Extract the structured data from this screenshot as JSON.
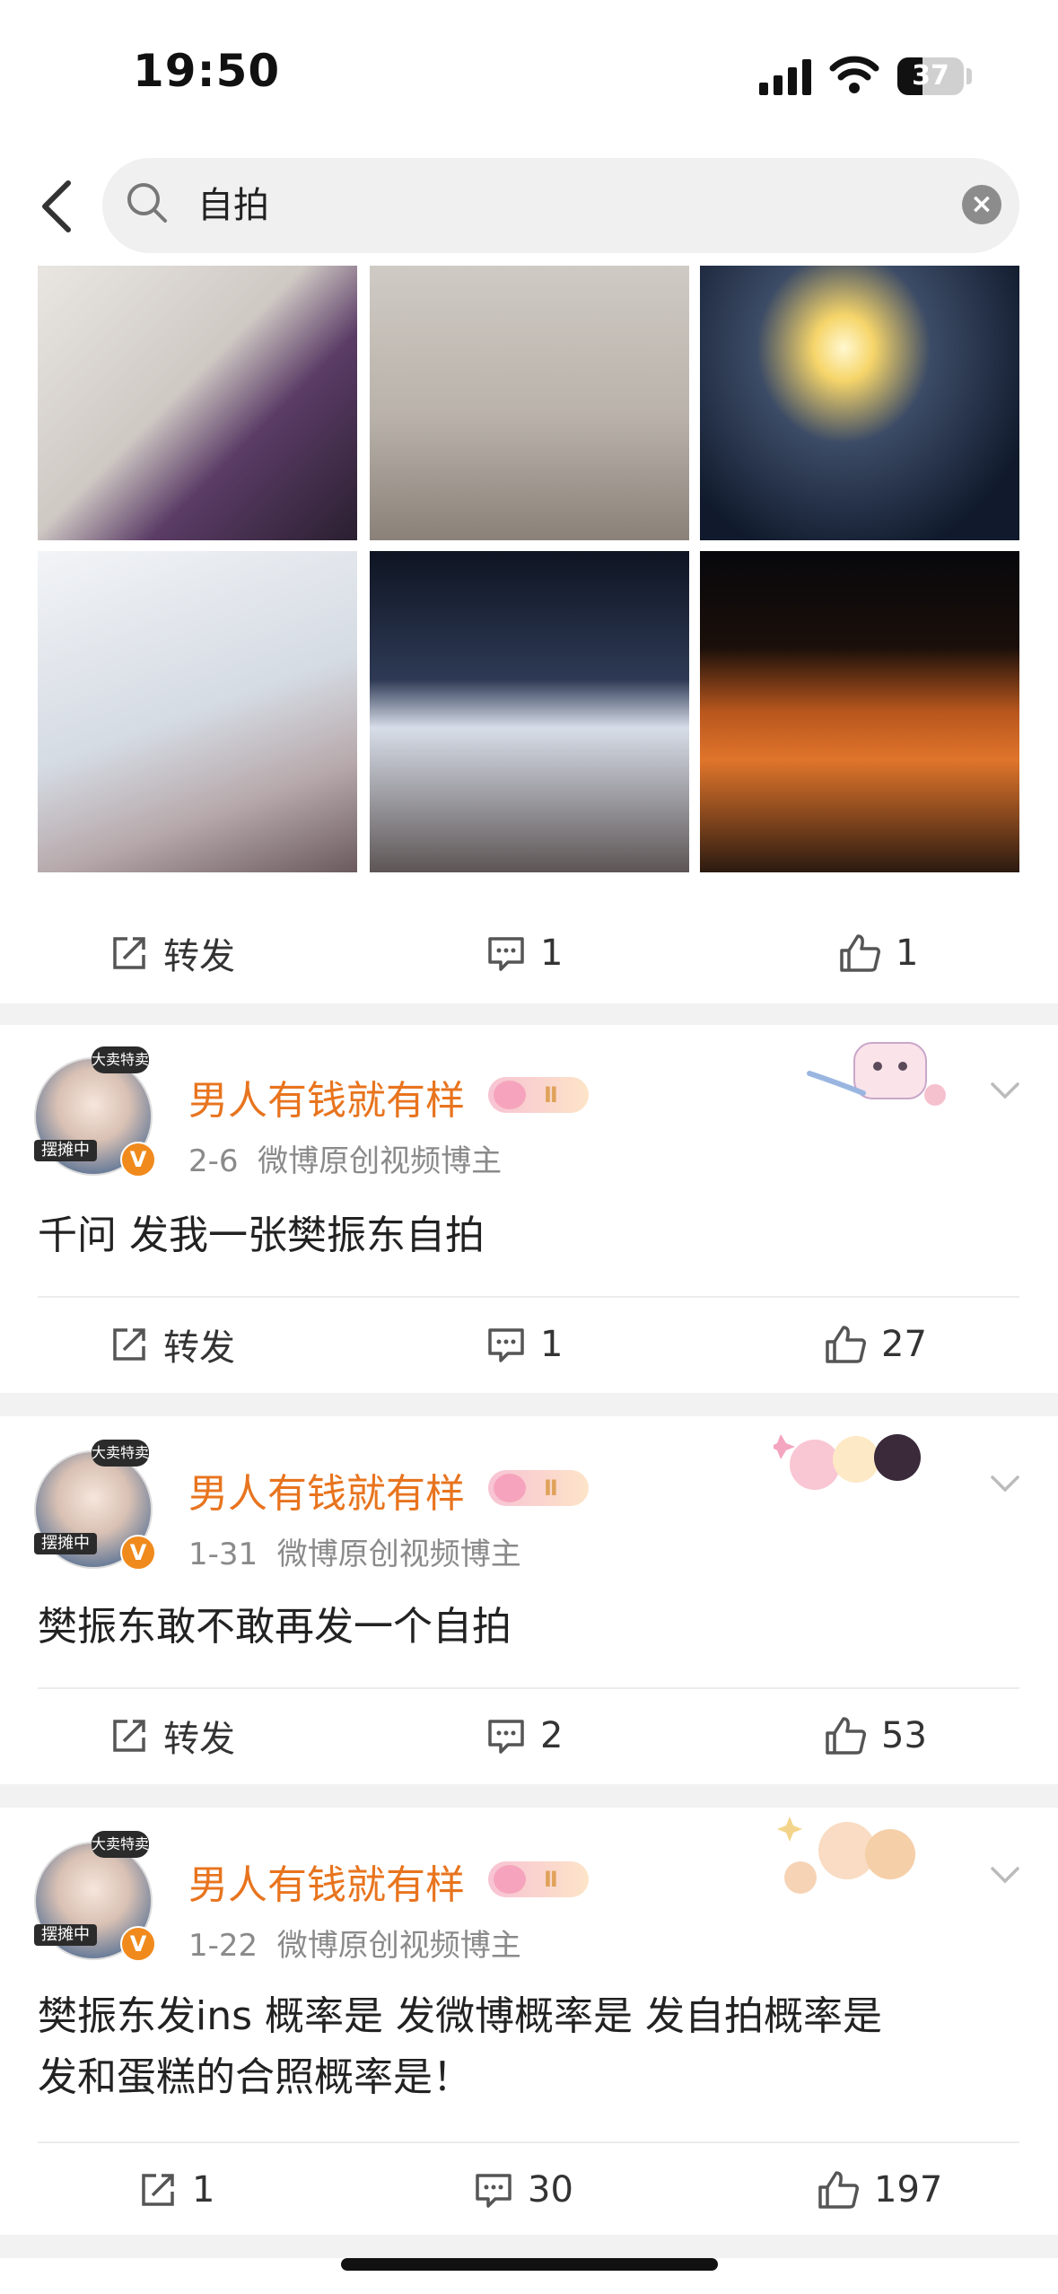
{
  "status_bar": {
    "time": "19:50",
    "battery": "37"
  },
  "search": {
    "query": "自拍"
  },
  "posts": [
    {
      "actions": {
        "repost": "转发",
        "comments": "1",
        "likes": "1"
      }
    },
    {
      "username": "男人有钱就有样",
      "date": "2-6",
      "source": "微博原创视频博主",
      "text": "千问 发我一张樊振东自拍",
      "actions": {
        "repost": "转发",
        "comments": "1",
        "likes": "27"
      }
    },
    {
      "username": "男人有钱就有样",
      "date": "1-31",
      "source": "微博原创视频博主",
      "text": "樊振东敢不敢再发一个自拍",
      "actions": {
        "repost": "转发",
        "comments": "2",
        "likes": "53"
      }
    },
    {
      "username": "男人有钱就有样",
      "date": "1-22",
      "source": "微博原创视频博主",
      "text_line1": "樊振东发ins 概率是 发微博概率是 发自拍概率是",
      "text_line2": "发和蛋糕的合照概率是！",
      "actions": {
        "repost": "1",
        "comments": "30",
        "likes": "197"
      }
    }
  ],
  "avatar": {
    "top_tag": "大卖特卖",
    "bottom_tag": "摆摊中",
    "badge": "V"
  },
  "vip_level": "Ⅱ",
  "colors": {
    "accent": "#e8741e",
    "background": "#f2f2f2",
    "text": "#222222"
  }
}
